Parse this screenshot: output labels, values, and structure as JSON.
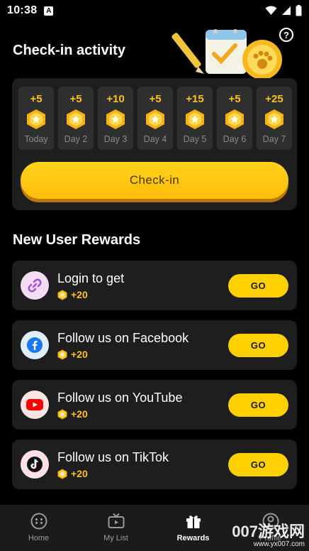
{
  "status_bar": {
    "time": "10:38",
    "notif": "A"
  },
  "header": {
    "title": "Check-in activity",
    "help_icon": "?"
  },
  "checkin": {
    "days": [
      {
        "pts": "+5",
        "label": "Today"
      },
      {
        "pts": "+5",
        "label": "Day 2"
      },
      {
        "pts": "+10",
        "label": "Day 3"
      },
      {
        "pts": "+5",
        "label": "Day 4"
      },
      {
        "pts": "+15",
        "label": "Day 5"
      },
      {
        "pts": "+5",
        "label": "Day 6"
      },
      {
        "pts": "+25",
        "label": "Day 7"
      }
    ],
    "button_label": "Check-in"
  },
  "new_user": {
    "title": "New User Rewards",
    "items": [
      {
        "name": "Login to get",
        "pts": "+20",
        "go": "GO",
        "icon": "link-icon"
      },
      {
        "name": "Follow us on Facebook",
        "pts": "+20",
        "go": "GO",
        "icon": "facebook-icon"
      },
      {
        "name": "Follow us on YouTube",
        "pts": "+20",
        "go": "GO",
        "icon": "youtube-icon"
      },
      {
        "name": "Follow us on TikTok",
        "pts": "+20",
        "go": "GO",
        "icon": "tiktok-icon"
      }
    ]
  },
  "tabs": [
    {
      "label": "Home",
      "icon": "home-icon"
    },
    {
      "label": "My List",
      "icon": "tv-icon"
    },
    {
      "label": "Rewards",
      "icon": "gift-icon",
      "active": true
    },
    {
      "label": "Profile",
      "icon": "profile-icon"
    }
  ],
  "watermark": {
    "line1": "007游戏网",
    "line2": "www.yx007.com"
  },
  "colors": {
    "accent": "#ffd000",
    "gold": "#ffc21a",
    "card": "#1e1e1e"
  }
}
